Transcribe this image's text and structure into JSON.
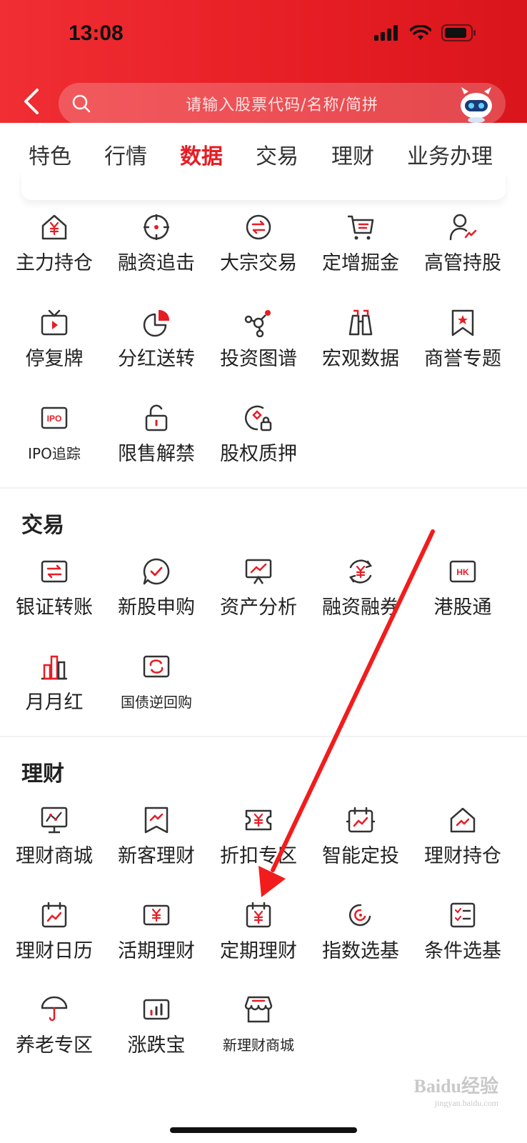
{
  "status": {
    "time": "13:08"
  },
  "search": {
    "placeholder": "请输入股票代码/名称/简拼"
  },
  "tabs": [
    {
      "label": "特色"
    },
    {
      "label": "行情"
    },
    {
      "label": "数据",
      "active": true
    },
    {
      "label": "交易"
    },
    {
      "label": "理财"
    },
    {
      "label": "业务办理"
    }
  ],
  "data_section": {
    "items": [
      {
        "label": "主力持仓",
        "icon": "house-yuan-icon"
      },
      {
        "label": "融资追击",
        "icon": "target-icon"
      },
      {
        "label": "大宗交易",
        "icon": "exchange-icon"
      },
      {
        "label": "定增掘金",
        "icon": "cart-icon"
      },
      {
        "label": "高管持股",
        "icon": "person-chart-icon"
      },
      {
        "label": "停复牌",
        "icon": "tv-play-icon"
      },
      {
        "label": "分红送转",
        "icon": "pie-chart-icon"
      },
      {
        "label": "投资图谱",
        "icon": "graph-nodes-icon"
      },
      {
        "label": "宏观数据",
        "icon": "binoculars-icon"
      },
      {
        "label": "商誉专题",
        "icon": "bookmark-star-icon"
      },
      {
        "label": "IPO追踪",
        "icon": "ipo-icon"
      },
      {
        "label": "限售解禁",
        "icon": "unlock-icon"
      },
      {
        "label": "股权质押",
        "icon": "pledge-lock-icon"
      }
    ]
  },
  "trade_section": {
    "title": "交易",
    "items": [
      {
        "label": "银证转账",
        "icon": "transfer-icon"
      },
      {
        "label": "新股申购",
        "icon": "chat-check-icon"
      },
      {
        "label": "资产分析",
        "icon": "presentation-chart-icon"
      },
      {
        "label": "融资融券",
        "icon": "yuan-cycle-icon"
      },
      {
        "label": "港股通",
        "icon": "hk-icon"
      },
      {
        "label": "月月红",
        "icon": "bar-building-icon"
      },
      {
        "label": "国债逆回购",
        "icon": "repo-cycle-icon"
      }
    ]
  },
  "finance_section": {
    "title": "理财",
    "items": [
      {
        "label": "理财商城",
        "icon": "monitor-chart-icon"
      },
      {
        "label": "新客理财",
        "icon": "bookmark-chart-icon"
      },
      {
        "label": "折扣专区",
        "icon": "ticket-yuan-icon"
      },
      {
        "label": "智能定投",
        "icon": "calendar-chart-icon"
      },
      {
        "label": "理财持仓",
        "icon": "house-chart-icon"
      },
      {
        "label": "理财日历",
        "icon": "calendar-trend-icon"
      },
      {
        "label": "活期理财",
        "icon": "card-yuan-icon"
      },
      {
        "label": "定期理财",
        "icon": "calendar-yuan-icon"
      },
      {
        "label": "指数选基",
        "icon": "swirl-icon"
      },
      {
        "label": "条件选基",
        "icon": "checklist-icon"
      },
      {
        "label": "养老专区",
        "icon": "umbrella-icon"
      },
      {
        "label": "涨跌宝",
        "icon": "bar-box-icon"
      },
      {
        "label": "新理财商城",
        "icon": "shop-icon"
      }
    ]
  },
  "watermark": {
    "text": "Baidu经验",
    "sub": "jingyan.baidu.com"
  },
  "colors": {
    "accent": "#e61d24",
    "header": "#f02e33",
    "icon_dark": "#333333"
  }
}
